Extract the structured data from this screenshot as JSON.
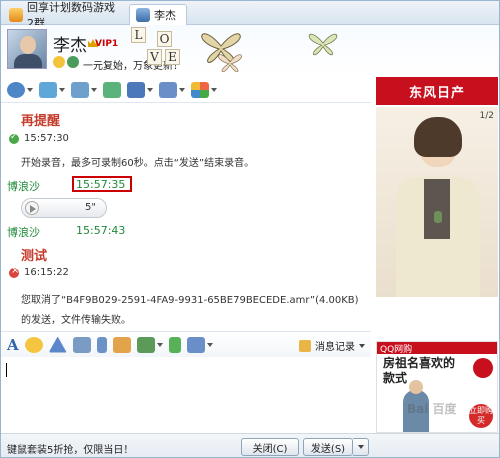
{
  "tabs": [
    {
      "label": "回享计划数码游戏2群"
    },
    {
      "label": "李杰"
    }
  ],
  "header": {
    "name": "李杰",
    "vip": "VIP1",
    "signature": "一元复始，万象更新！",
    "love_letters": [
      "L",
      "O",
      "V",
      "E"
    ]
  },
  "chat": {
    "messages": [
      {
        "sender": "再提醒",
        "time": "15:57:30",
        "text": "开始录音，最多可录制60秒。点击“发送”结束录音。"
      },
      {
        "sender": "博浪沙",
        "time": "15:57:35",
        "voice_duration": "5\""
      },
      {
        "sender": "博浪沙",
        "time": "15:57:43"
      },
      {
        "sender": "测试",
        "time": "16:15:22",
        "text1": "您取消了“B4F9B029-2591-4FA9-9931-65BE79BECEDE.amr”(4.00KB)",
        "text2": "的发送，文件传输失败。"
      }
    ]
  },
  "input_toolbar": {
    "font_glyph": "A",
    "history_label": "消息记录"
  },
  "bottom": {
    "promo": "键鼠套装5折抢，仅限当日！",
    "close_label": "关闭(C)",
    "send_label": "发送(S)"
  },
  "ads": {
    "top_brand": "东风日产",
    "pager": "1/2",
    "qq_label": "QQ网购",
    "bottom_title": "房祖名喜欢的款式",
    "buy_label": "立即购买",
    "watermark": "Bai 百度"
  },
  "colors": {
    "sender_red": "#c53d2d",
    "time_green": "#1e8a3a",
    "ad_red": "#c80f1e",
    "highlight": "#cc0000"
  }
}
